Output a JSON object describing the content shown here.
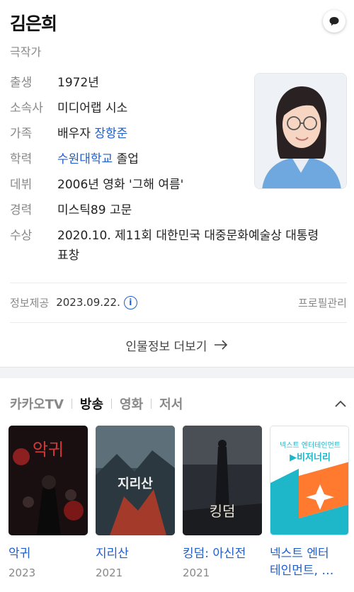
{
  "profile": {
    "name": "김은희",
    "occupation": "극작가"
  },
  "info": {
    "birth_label": "출생",
    "birth_value": "1972년",
    "agency_label": "소속사",
    "agency_value": "미디어랩 시소",
    "family_label": "가족",
    "family_prefix": "배우자",
    "family_spouse": "장항준",
    "education_label": "학력",
    "education_school": "수원대학교",
    "education_suffix": "졸업",
    "debut_label": "데뷔",
    "debut_value": "2006년 영화 '그해 여름'",
    "career_label": "경력",
    "career_value": "미스틱89 고문",
    "award_label": "수상",
    "award_line1": "2020.10. 제11회 대한민국 대중문화예술상 대통령",
    "award_line2": "표창"
  },
  "meta": {
    "provided_label": "정보제공",
    "provided_date": "2023.09.22.",
    "info_icon_text": "i",
    "manage_label": "프로필관리"
  },
  "more_link": "인물정보 더보기",
  "tabs": [
    "카카오TV",
    "방송",
    "영화",
    "저서"
  ],
  "active_tab": "방송",
  "works": [
    {
      "title": "악귀",
      "year": "2023",
      "poster_text": "악귀"
    },
    {
      "title": "지리산",
      "year": "2021",
      "poster_text": "지리산"
    },
    {
      "title": "킹덤: 아신전",
      "year": "2021",
      "poster_text": "킹덤"
    },
    {
      "title": "넥스트 엔터",
      "title_line2": "테인먼트, …",
      "poster_text": "넥스트 엔터테인먼트",
      "poster_text2": "▶비저너리"
    }
  ],
  "colors": {
    "link": "#1f5fcc",
    "muted": "#888888",
    "text": "#222222"
  }
}
